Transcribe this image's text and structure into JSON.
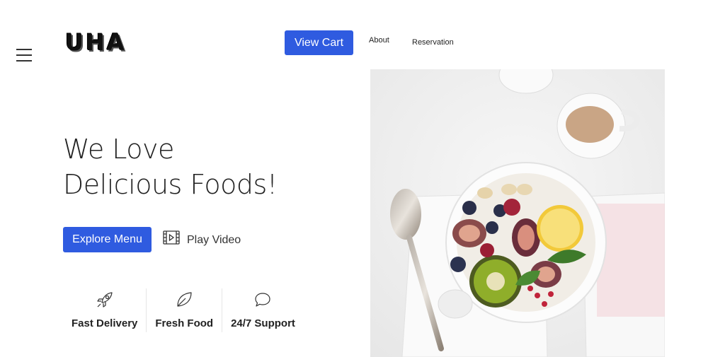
{
  "header": {
    "logo_text": "UHA",
    "cart_label": "View Cart",
    "nav": [
      {
        "label": "About"
      },
      {
        "label": "Reservation"
      }
    ]
  },
  "hero": {
    "headline_line1": "We Love",
    "headline_line2": "Delicious Foods!",
    "explore_label": "Explore Menu",
    "play_label": "Play Video",
    "image_alt": "bowl-of-fruit-yogurt-icon"
  },
  "features": [
    {
      "icon": "rocket-icon",
      "label": "Fast Delivery"
    },
    {
      "icon": "leaf-icon",
      "label": "Fresh Food"
    },
    {
      "icon": "chat-bubble-icon",
      "label": "24/7 Support"
    }
  ],
  "colors": {
    "accent": "#2f5be0",
    "text": "#222222",
    "background": "#ffffff"
  }
}
